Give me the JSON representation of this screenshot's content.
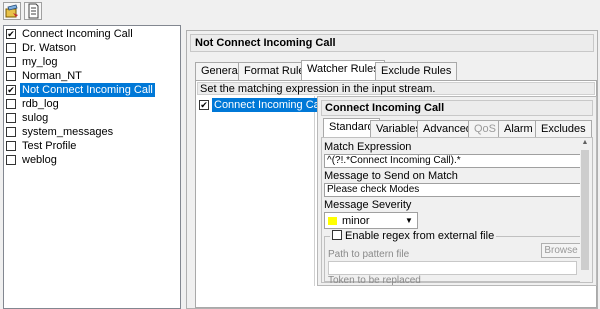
{
  "toolbar": {
    "buttons": [
      {
        "icon": "edit-rules-icon"
      },
      {
        "icon": "document-icon"
      }
    ]
  },
  "profiles": [
    {
      "label": "Connect Incoming Call",
      "checked": true,
      "selected": false
    },
    {
      "label": "Dr. Watson",
      "checked": false,
      "selected": false
    },
    {
      "label": "my_log",
      "checked": false,
      "selected": false
    },
    {
      "label": "Norman_NT",
      "checked": false,
      "selected": false
    },
    {
      "label": "Not Connect Incoming Call",
      "checked": true,
      "selected": true
    },
    {
      "label": "rdb_log",
      "checked": false,
      "selected": false
    },
    {
      "label": "sulog",
      "checked": false,
      "selected": false
    },
    {
      "label": "system_messages",
      "checked": false,
      "selected": false
    },
    {
      "label": "Test Profile",
      "checked": false,
      "selected": false
    },
    {
      "label": "weblog",
      "checked": false,
      "selected": false
    }
  ],
  "profile_title": "Not Connect Incoming Call",
  "main_tabs": [
    {
      "label": "General",
      "active": false
    },
    {
      "label": "Format Rules",
      "active": false
    },
    {
      "label": "Watcher Rules",
      "active": true
    },
    {
      "label": "Exclude Rules",
      "active": false
    }
  ],
  "watcher_description": "Set the matching expression in the input stream.",
  "rules": [
    {
      "label": "Connect Incoming Call",
      "checked": true
    }
  ],
  "rule_title": "Connect Incoming Call",
  "rule_tabs": [
    {
      "label": "Standard",
      "active": true,
      "disabled": false
    },
    {
      "label": "Variables",
      "active": false,
      "disabled": false
    },
    {
      "label": "Advanced",
      "active": false,
      "disabled": false
    },
    {
      "label": "QoS",
      "active": false,
      "disabled": true
    },
    {
      "label": "Alarm",
      "active": false,
      "disabled": false
    },
    {
      "label": "Excludes",
      "active": false,
      "disabled": false
    }
  ],
  "form": {
    "match_label": "Match Expression",
    "match_value": "^(?!.*Connect Incoming Call).*",
    "message_label": "Message to Send on Match",
    "message_value": "Please check Modes",
    "severity_label": "Message Severity",
    "severity_value": "minor",
    "severity_color": "#ffff00",
    "regex_label": "Enable regex from external file",
    "browse_label": "Browse",
    "path_label": "Path to pattern file",
    "token_label": "Token to be replaced"
  }
}
